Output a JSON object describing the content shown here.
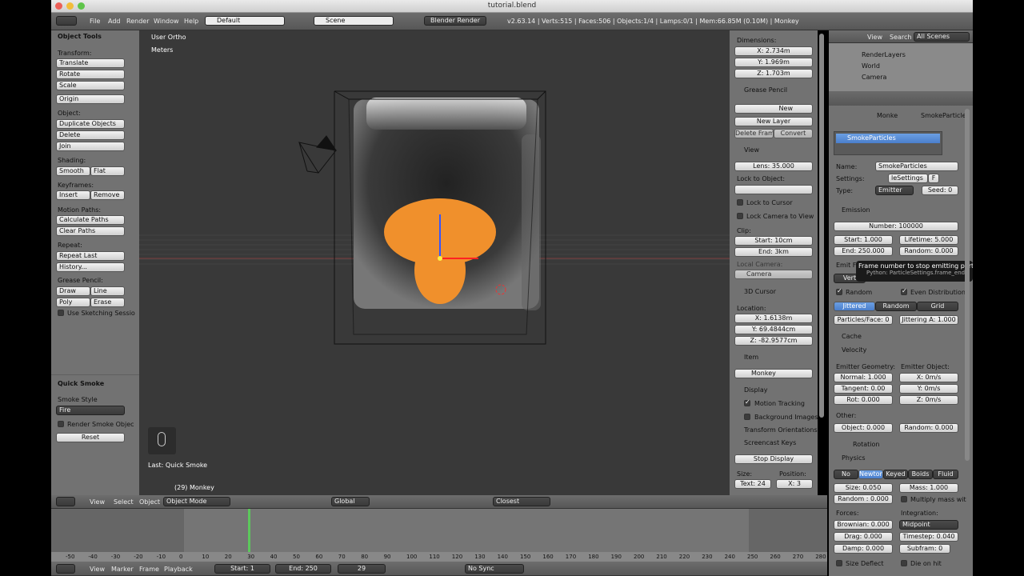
{
  "window": {
    "title": "tutorial.blend"
  },
  "info": {
    "menus": [
      "File",
      "Add",
      "Render",
      "Window",
      "Help"
    ],
    "layout": "Default",
    "scene": "Scene",
    "engine": "Blender Render",
    "stats": "v2.63.14 | Verts:515 | Faces:506 | Objects:1/4 | Lamps:0/1 | Mem:66.85M (0.10M) | Monkey"
  },
  "tools": {
    "header": "Object Tools",
    "transform_label": "Transform:",
    "translate": "Translate",
    "rotate": "Rotate",
    "scale": "Scale",
    "origin": "Origin",
    "object_label": "Object:",
    "duplicate": "Duplicate Objects",
    "delete": "Delete",
    "join": "Join",
    "shading_label": "Shading:",
    "smooth": "Smooth",
    "flat": "Flat",
    "keyframes_label": "Keyframes:",
    "insert": "Insert",
    "remove": "Remove",
    "motion_label": "Motion Paths:",
    "calc_paths": "Calculate Paths",
    "clear_paths": "Clear Paths",
    "repeat_label": "Repeat:",
    "repeat_last": "Repeat Last",
    "history": "History...",
    "gp_label": "Grease Pencil:",
    "draw": "Draw",
    "line": "Line",
    "poly": "Poly",
    "erase": "Erase",
    "sketch": "Use Sketching Sessio"
  },
  "quick_smoke": {
    "header": "Quick Smoke",
    "style_label": "Smoke Style",
    "style": "Fire",
    "render_label": "Render Smoke Objec",
    "reset": "Reset"
  },
  "viewport": {
    "view_name": "User Ortho",
    "units": "Meters",
    "last_op": "Last: Quick Smoke",
    "object_label": "(29) Monkey"
  },
  "view3d_header": {
    "view": "View",
    "select": "Select",
    "object": "Object",
    "mode": "Object Mode",
    "orientation": "Global",
    "snap": "Closest"
  },
  "properties_n": {
    "dimensions_label": "Dimensions:",
    "dim_x": "X: 2.734m",
    "dim_y": "Y: 1.969m",
    "dim_z": "Z: 1.703m",
    "grease_pencil": "Grease Pencil",
    "new": "New",
    "new_layer": "New Layer",
    "delete_frame": "Delete Frame",
    "convert": "Convert",
    "view": "View",
    "lens": "Lens: 35.000",
    "lock_to_object": "Lock to Object:",
    "lock_cursor": "Lock to Cursor",
    "lock_camera": "Lock Camera to View",
    "clip_label": "Clip:",
    "clip_start": "Start: 10cm",
    "clip_end": "End: 3km",
    "local_camera": "Local Camera:",
    "camera": "Camera",
    "cursor": "3D Cursor",
    "location_label": "Location:",
    "cx": "X: 1.6138m",
    "cy": "Y: 69.4844cm",
    "cz": "Z: -82.9577cm",
    "item": "Item",
    "item_name": "Monkey",
    "display": "Display",
    "motion_tracking": "Motion Tracking",
    "bg_images": "Background Images",
    "transform_orient": "Transform Orientations",
    "screencast": "Screencast Keys",
    "stop_display": "Stop Display",
    "size_label": "Size:",
    "position_label": "Position:",
    "text_size": "Text: 24",
    "pos_x": "X: 3"
  },
  "outliner": {
    "view": "View",
    "search": "Search",
    "filter": "All Scenes",
    "items": [
      "RenderLayers",
      "World",
      "Camera"
    ]
  },
  "particles": {
    "breadcrumb_obj": "Monke",
    "breadcrumb_sys": "SmokeParticles",
    "system": "SmokeParticles",
    "name_label": "Name:",
    "name": "SmokeParticles",
    "settings_label": "Settings:",
    "settings": "leSettings",
    "f": "F",
    "type_label": "Type:",
    "type": "Emitter",
    "seed": "Seed: 0",
    "emission": "Emission",
    "number": "Number: 100000",
    "start": "Start: 1.000",
    "lifetime": "Lifetime: 5.000",
    "end": "End: 250.000",
    "random": "Random: 0.000",
    "emit_from": "Emit F",
    "verts": "Vert",
    "tooltip": "Frame number to stop emitting particles",
    "tooltip_py": "Python: ParticleSettings.frame_end",
    "random_chk": "Random",
    "even": "Even Distribution",
    "jittered": "Jittered",
    "random_btn": "Random",
    "grid": "Grid",
    "ppf": "Particles/Face: 0",
    "jitter_amt": "Jittering A: 1.000",
    "cache": "Cache",
    "velocity": "Velocity",
    "emitter_geo": "Emitter Geometry:",
    "emitter_obj": "Emitter Object:",
    "normal": "Normal: 1.000",
    "tangent": "Tangent: 0.00",
    "rot": "Rot: 0.000",
    "vx": "X: 0m/s",
    "vy": "Y: 0m/s",
    "vz": "Z: 0m/s",
    "other": "Other:",
    "object_v": "Object: 0.000",
    "random_v": "Random: 0.000",
    "rotation": "Rotation",
    "physics": "Physics",
    "phys_types": [
      "No",
      "Newton",
      "Keyed",
      "Boids",
      "Fluid"
    ],
    "size": "Size: 0.050",
    "mass": "Mass: 1.000",
    "random_size": "Random : 0.000",
    "multiply_mass": "Multiply mass wit",
    "forces": "Forces:",
    "integration": "Integration:",
    "brownian": "Brownian: 0.000",
    "integrator": "Midpoint",
    "drag": "Drag: 0.000",
    "timestep": "Timestep: 0.040",
    "damp": "Damp: 0.000",
    "subframe": "Subfram: 0",
    "size_deflect": "Size Deflect",
    "die_on_hit": "Die on hit"
  },
  "timeline": {
    "ticks": [
      "-50",
      "-40",
      "-30",
      "-20",
      "-10",
      "0",
      "10",
      "20",
      "30",
      "40",
      "50",
      "60",
      "70",
      "80",
      "90",
      "100",
      "110",
      "120",
      "130",
      "140",
      "150",
      "160",
      "170",
      "180",
      "190",
      "200",
      "210",
      "220",
      "230",
      "240",
      "250",
      "260",
      "270",
      "280"
    ],
    "current_frame": 29,
    "view": "View",
    "marker": "Marker",
    "frame": "Frame",
    "playback": "Playback",
    "start": "Start: 1",
    "end": "End: 250",
    "frame_value": "29",
    "sync": "No Sync"
  }
}
